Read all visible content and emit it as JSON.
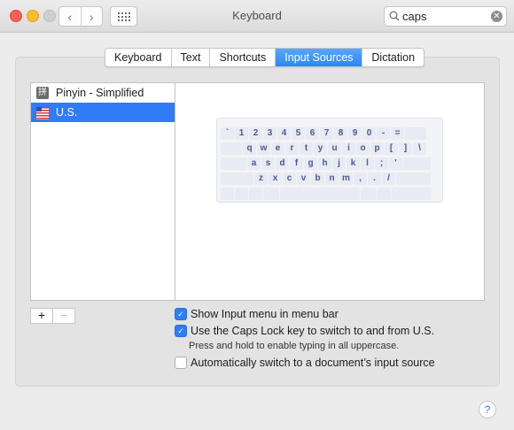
{
  "window": {
    "title": "Keyboard"
  },
  "toolbar": {
    "back_icon": "‹",
    "forward_icon": "›",
    "grid_icon": "grid-icon"
  },
  "search": {
    "value": "caps",
    "clear_icon": "✕"
  },
  "tabs": [
    {
      "label": "Keyboard",
      "active": false
    },
    {
      "label": "Text",
      "active": false
    },
    {
      "label": "Shortcuts",
      "active": false
    },
    {
      "label": "Input Sources",
      "active": true
    },
    {
      "label": "Dictation",
      "active": false
    }
  ],
  "sources": [
    {
      "label": "Pinyin - Simplified",
      "icon": "拼",
      "selected": false
    },
    {
      "label": "U.S.",
      "icon": "us-flag-icon",
      "selected": true
    }
  ],
  "keyboard": {
    "rows": [
      [
        "`",
        "1",
        "2",
        "3",
        "4",
        "5",
        "6",
        "7",
        "8",
        "9",
        "0",
        "-",
        "="
      ],
      [
        "q",
        "w",
        "e",
        "r",
        "t",
        "y",
        "u",
        "i",
        "o",
        "p",
        "[",
        "]",
        "\\"
      ],
      [
        "a",
        "s",
        "d",
        "f",
        "g",
        "h",
        "j",
        "k",
        "l",
        ";",
        "'"
      ],
      [
        "z",
        "x",
        "c",
        "v",
        "b",
        "n",
        "m",
        ",",
        ".",
        "/"
      ]
    ]
  },
  "list_buttons": {
    "add": "+",
    "remove": "−"
  },
  "options": {
    "show_menu": {
      "label": "Show Input menu in menu bar",
      "checked": true
    },
    "caps_lock": {
      "label": "Use the Caps Lock key to switch to and from U.S.",
      "checked": true
    },
    "caps_hint": "Press and hold to enable typing in all uppercase.",
    "auto_switch": {
      "label": "Automatically switch to a document’s input source",
      "checked": false
    }
  },
  "help": {
    "label": "?"
  },
  "colors": {
    "accent": "#2f7cf6",
    "key_text": "#4a5a93"
  }
}
